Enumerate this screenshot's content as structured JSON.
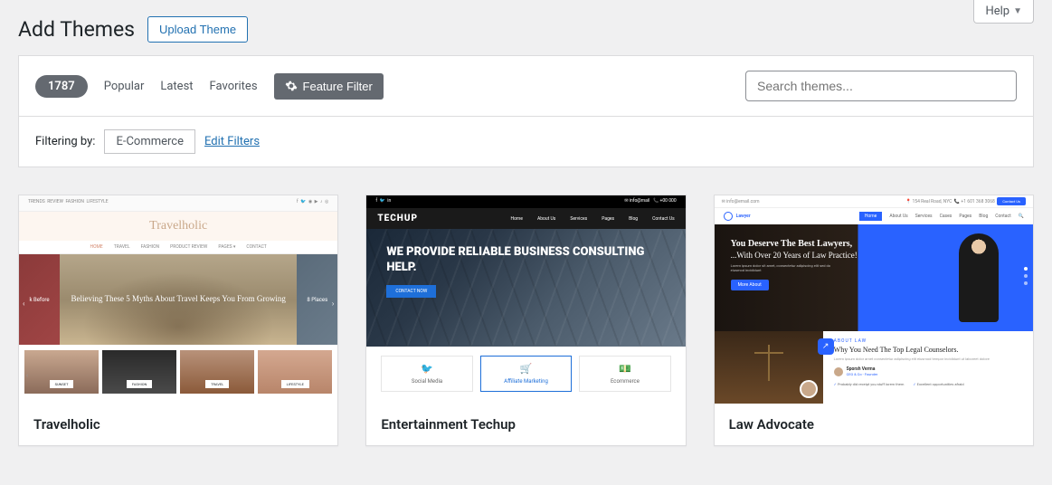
{
  "help": {
    "label": "Help"
  },
  "header": {
    "title": "Add Themes",
    "upload_label": "Upload Theme"
  },
  "filter_bar": {
    "count": "1787",
    "tabs": {
      "popular": "Popular",
      "latest": "Latest",
      "favorites": "Favorites"
    },
    "feature_filter_label": "Feature Filter",
    "search_placeholder": "Search themes..."
  },
  "filtering": {
    "label": "Filtering by:",
    "active_filter": "E-Commerce",
    "edit_label": "Edit Filters"
  },
  "themes": [
    {
      "name": "Travelholic"
    },
    {
      "name": "Entertainment Techup"
    },
    {
      "name": "Law Advocate"
    }
  ],
  "preview": {
    "travelholic": {
      "logo": "Travelholic",
      "nav": [
        "HOME",
        "TRAVEL",
        "FASHION",
        "PRODUCT REVIEW",
        "PAGES ▾",
        "CONTACT"
      ],
      "topcats": [
        "TRENDS",
        "REVIEW",
        "FASHION",
        "LIFESTYLE"
      ],
      "left_tile": "k Before",
      "right_tile": "8 Places",
      "headline": "Believing These 5 Myths About Travel Keeps You From Growing",
      "thumbs": [
        "SUNSET",
        "FASHION",
        "TRAVEL",
        "LIFESTYLE"
      ]
    },
    "techup": {
      "logo": "TECHUP",
      "nav": [
        "Home",
        "About Us",
        "Services",
        "Pages",
        "Blog",
        "Contact Us"
      ],
      "headline": "WE PROVIDE RELIABLE BUSINESS CONSULTING HELP.",
      "cta": "CONTACT NOW",
      "cards": [
        {
          "icon": "🐦",
          "label": "Social Media"
        },
        {
          "icon": "🛒",
          "label": "Affiliate Marketing"
        },
        {
          "icon": "💵",
          "label": "Ecommerce"
        }
      ]
    },
    "law": {
      "top_email": "✉ info@email.com",
      "top_addr": "📍 154 Real Road, NYC",
      "top_phone": "📞 +1 601 368 3068",
      "contact_btn": "Contact Us",
      "brand": "Lawyer",
      "nav": [
        "Home",
        "About Us",
        "Services",
        "Cases",
        "Pages",
        "Blog",
        "Contact"
      ],
      "hero1": "You Deserve The Best Lawyers,",
      "hero2": "...With Over 20 Years of Law Practice!",
      "sub": "Lorem ipsum dolor sit amet, consectetur adipiscing elit sed do eiusmod incididunt",
      "hero_btn": "More About",
      "about_tag": "ABOUT LAW",
      "why": "Why You Need The Top Legal Counselors.",
      "lorem": "Lorem ipsum dolor amet consectetur adipiscing elit eiusmod tempor incididunt ut laboreet dolore",
      "author_name": "Sporsh Verma",
      "author_role": "CEO & Co - Founder",
      "bullets": [
        "Probably did receipt you stuff lorem them",
        "Excellent opportunities afraid"
      ]
    }
  }
}
